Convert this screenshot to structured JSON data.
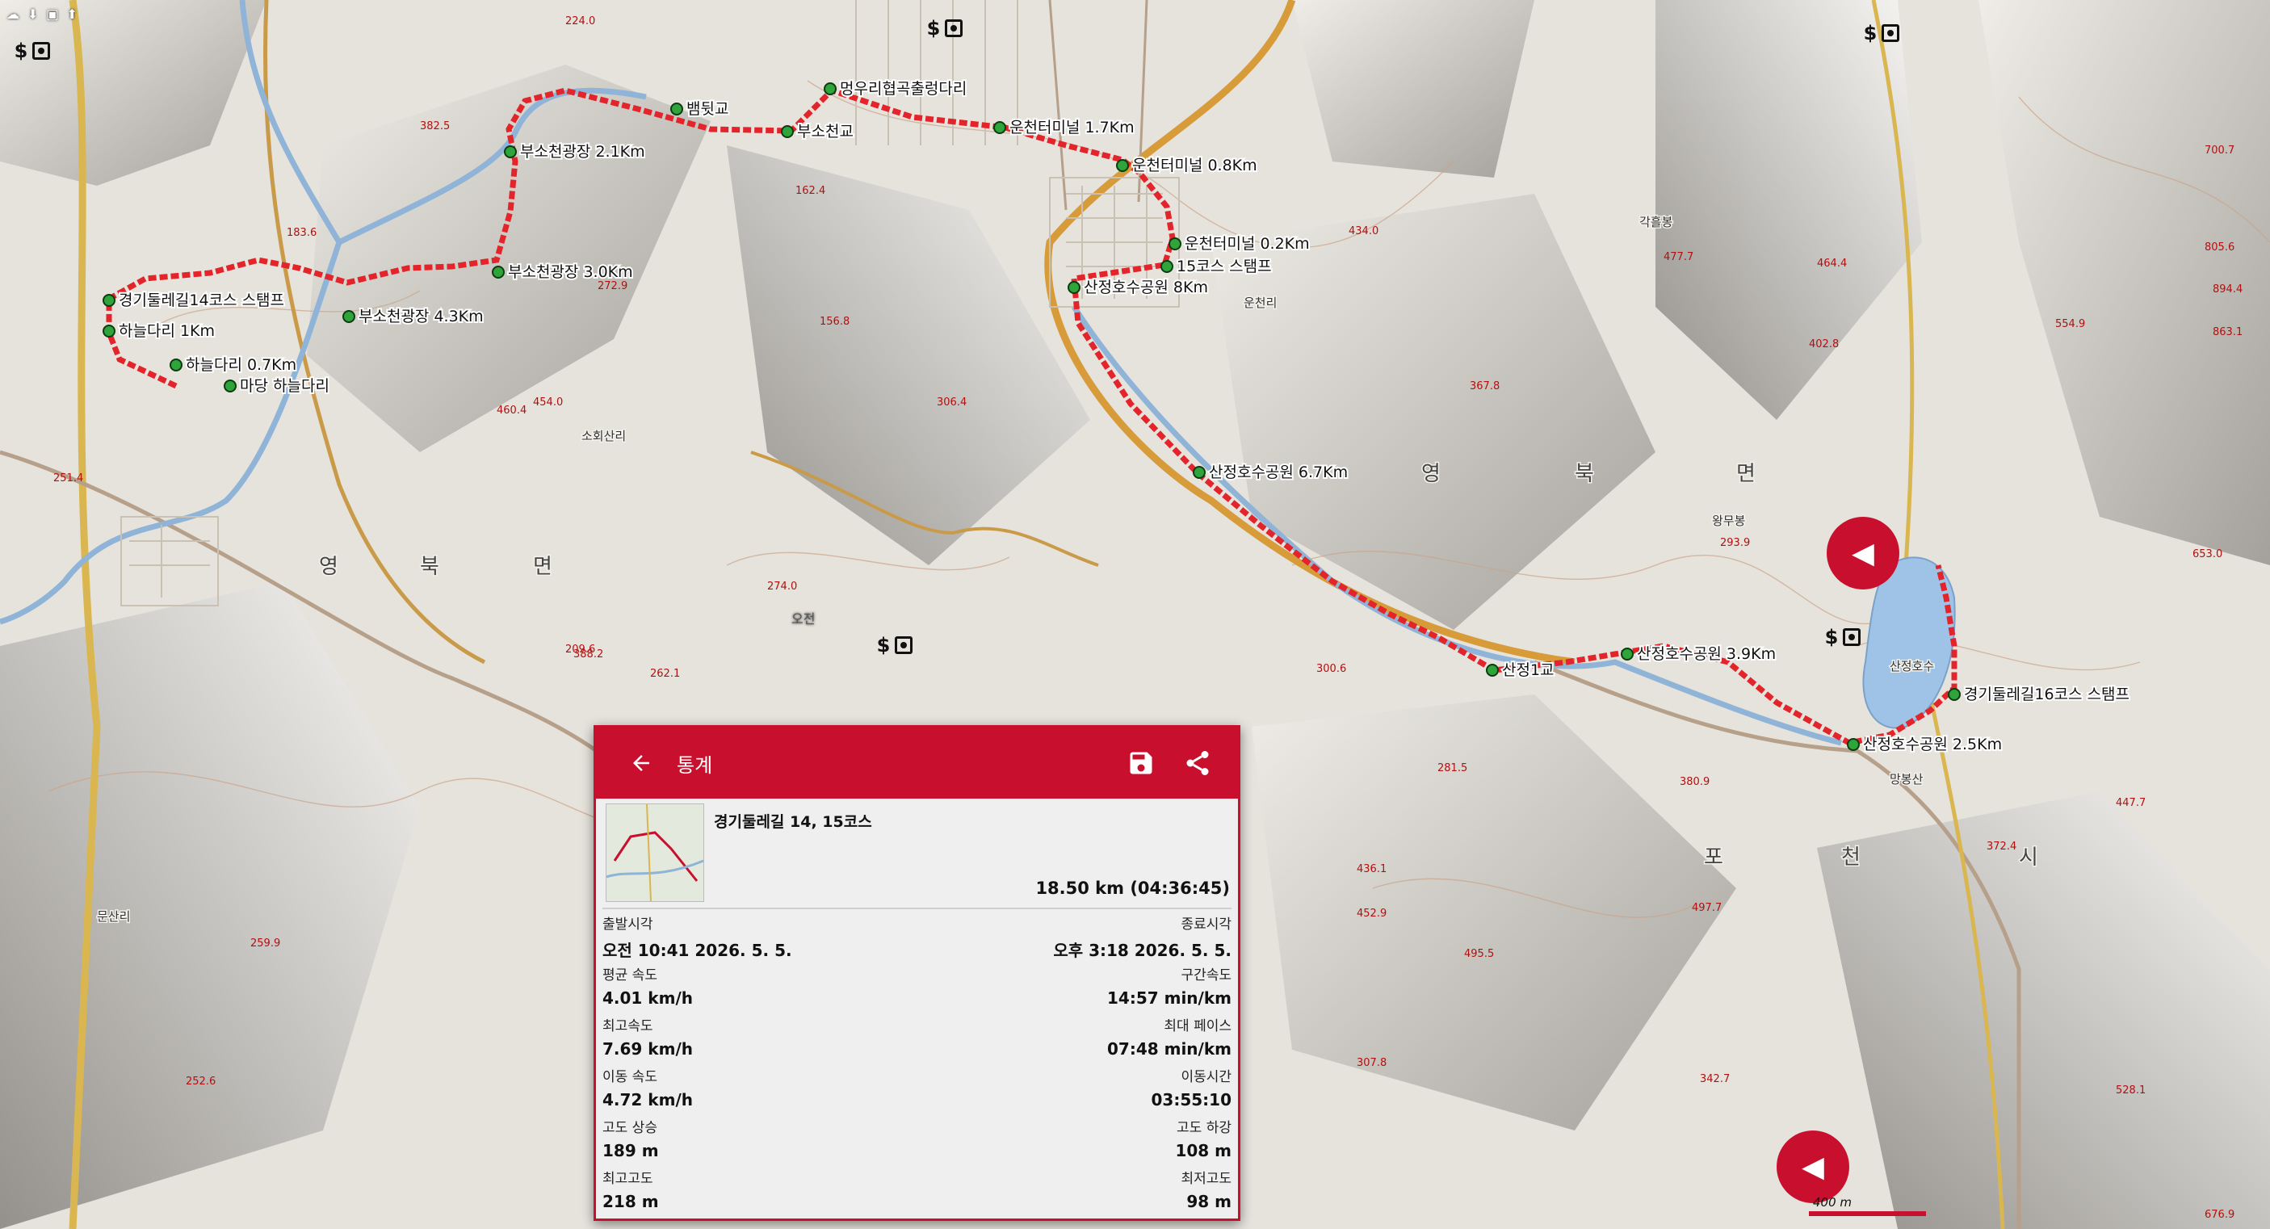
{
  "map": {
    "route_color": "#e3242b",
    "accent_color": "#c8102e",
    "waypoints": [
      {
        "label": "뱀뒷교"
      },
      {
        "label": "멍우리협곡출렁다리"
      },
      {
        "label": "부소천교"
      },
      {
        "label": "운천터미널 1.7Km"
      },
      {
        "label": "부소천광장 2.1Km"
      },
      {
        "label": "운천터미널 0.8Km"
      },
      {
        "label": "운천터미널 0.2Km"
      },
      {
        "label": "15코스 스탬프"
      },
      {
        "label": "산정호수공원 8Km"
      },
      {
        "label": "부소천광장 3.0Km"
      },
      {
        "label": "경기둘레길14코스 스탬프"
      },
      {
        "label": "부소천광장 4.3Km"
      },
      {
        "label": "하늘다리 1Km"
      },
      {
        "label": "하늘다리 0.7Km"
      },
      {
        "label": "마당 하늘다리"
      },
      {
        "label": "산정호수공원 6.7Km"
      },
      {
        "label": "산정호수공원 3.9Km"
      },
      {
        "label": "산정1교"
      },
      {
        "label": "경기둘레길16코스 스탬프"
      },
      {
        "label": "산정호수공원 2.5Km"
      }
    ],
    "places": [
      "영",
      "북",
      "면",
      "영",
      "북",
      "면",
      "포",
      "천",
      "시",
      "산정호수",
      "운천리",
      "소회산리",
      "문산리",
      "망봉산",
      "각흘봉",
      "왕무봉"
    ],
    "peaks": [
      "224.0",
      "382.5",
      "183.6",
      "272.9",
      "460.4",
      "454.0",
      "306.4",
      "162.4",
      "156.8",
      "434.0",
      "477.7",
      "464.4",
      "402.8",
      "367.8",
      "293.9",
      "300.6",
      "281.5",
      "436.1",
      "452.9",
      "495.5",
      "380.9",
      "497.7",
      "447.7",
      "372.4",
      "528.1",
      "676.9",
      "653.0",
      "805.6",
      "894.4",
      "863.1",
      "554.9",
      "700.7",
      "342.7",
      "307.8",
      "252.6",
      "259.9",
      "251.4",
      "274.0",
      "388.2",
      "262.1",
      "209.6"
    ],
    "scale_label": "400 m"
  },
  "status_icons": {
    "gps_symbol": "$",
    "ghost_time": "오전"
  },
  "side_buttons": {
    "upper": "◀",
    "lower": "◀"
  },
  "dialog": {
    "title": "통계",
    "back_icon": "arrow-left-icon",
    "save_icon": "save-icon",
    "share_icon": "share-icon",
    "track_name": "경기둘레길 14, 15코스",
    "total": "18.50 km (04:36:45)",
    "stats": [
      {
        "left_label": "출발시각",
        "left_value": "오전 10:41 2026. 5. 5.",
        "right_label": "종료시각",
        "right_value": "오후 3:18 2026. 5. 5."
      },
      {
        "left_label": "평균 속도",
        "left_value": "4.01 km/h",
        "right_label": "구간속도",
        "right_value": "14:57 min/km"
      },
      {
        "left_label": "최고속도",
        "left_value": "7.69 km/h",
        "right_label": "최대 페이스",
        "right_value": "07:48 min/km"
      },
      {
        "left_label": "이동 속도",
        "left_value": "4.72 km/h",
        "right_label": "이동시간",
        "right_value": "03:55:10"
      },
      {
        "left_label": "고도 상승",
        "left_value": "189 m",
        "right_label": "고도 하강",
        "right_value": "108 m"
      },
      {
        "left_label": "최고고도",
        "left_value": "218 m",
        "right_label": "최저고도",
        "right_value": "98 m"
      }
    ]
  }
}
